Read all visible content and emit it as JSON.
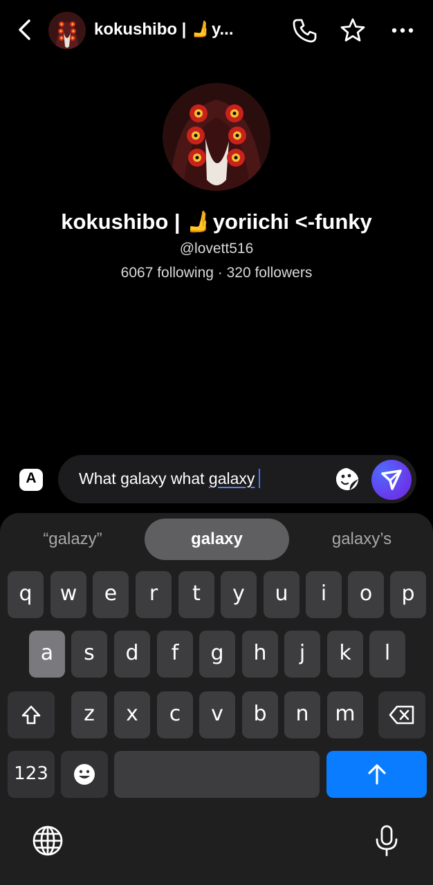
{
  "header": {
    "title": "kokushibo | 🫸y...",
    "back_icon": "chevron-left-icon",
    "call_icon": "phone-icon",
    "star_icon": "star-icon",
    "more_icon": "more-horizontal-icon"
  },
  "profile": {
    "name": "kokushibo | 🫸yoriichi <-funky",
    "handle": "@lovett516",
    "stats": "6067 following · 320 followers"
  },
  "composer": {
    "translate_label": "A",
    "text_before": "What galaxy what ",
    "text_underlined": "galaxy",
    "sticker_icon": "sticker-icon",
    "send_icon": "send-icon",
    "send_color": "#5b4ff0"
  },
  "keyboard": {
    "suggestions": [
      "“galazy”",
      "galaxy",
      "galaxy’s"
    ],
    "row1": [
      "q",
      "w",
      "e",
      "r",
      "t",
      "y",
      "u",
      "i",
      "o",
      "p"
    ],
    "row2": [
      "a",
      "s",
      "d",
      "f",
      "g",
      "h",
      "j",
      "k",
      "l"
    ],
    "row3": [
      "z",
      "x",
      "c",
      "v",
      "b",
      "n",
      "m"
    ],
    "numbers_label": "123",
    "pressed_key": "a",
    "return_color": "#0a7cff"
  }
}
